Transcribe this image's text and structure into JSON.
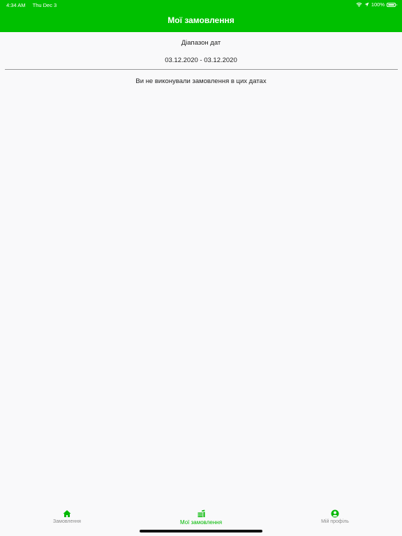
{
  "status_bar": {
    "time": "4:34 AM",
    "date": "Thu Dec 3",
    "battery": "100%",
    "icons": [
      "wifi-icon",
      "location-arrow-icon",
      "battery-icon"
    ]
  },
  "header": {
    "title": "Мої замовлення"
  },
  "date_filter": {
    "label": "Діапазон дат",
    "range": "03.12.2020 - 03.12.2020"
  },
  "empty_state": {
    "message": "Ви не виконували замовлення в цих датах"
  },
  "tab_bar": {
    "active_color": "#00b800",
    "inactive_color": "#8a8a8a",
    "items": [
      {
        "label": "Замовлення",
        "icon": "home-icon",
        "active": false
      },
      {
        "label": "Мої замовлення",
        "icon": "orders-list-icon",
        "active": true
      },
      {
        "label": "Мій профіль",
        "icon": "profile-icon",
        "active": false
      }
    ]
  },
  "colors": {
    "header": "#00c000",
    "background": "#f9f9fa"
  }
}
